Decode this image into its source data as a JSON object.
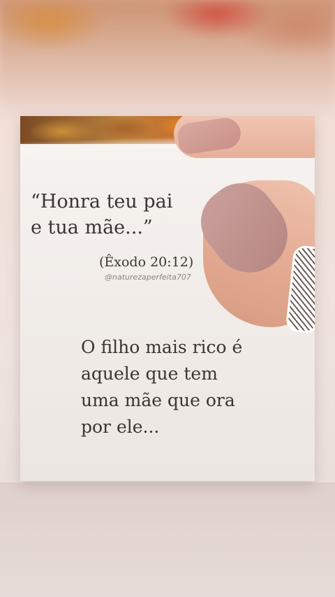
{
  "quote": {
    "text": "“Honra teu pai\ne tua mãe...”",
    "reference": "(Êxodo 20:12)",
    "handle": "@naturezaperfeita707"
  },
  "message": {
    "text": "O filho mais rico é\naquele que tem\numa mãe que ora\npor ele..."
  },
  "colors": {
    "text": "#3b3433",
    "paper": "#f3eeeb",
    "nail": "#c89088"
  }
}
